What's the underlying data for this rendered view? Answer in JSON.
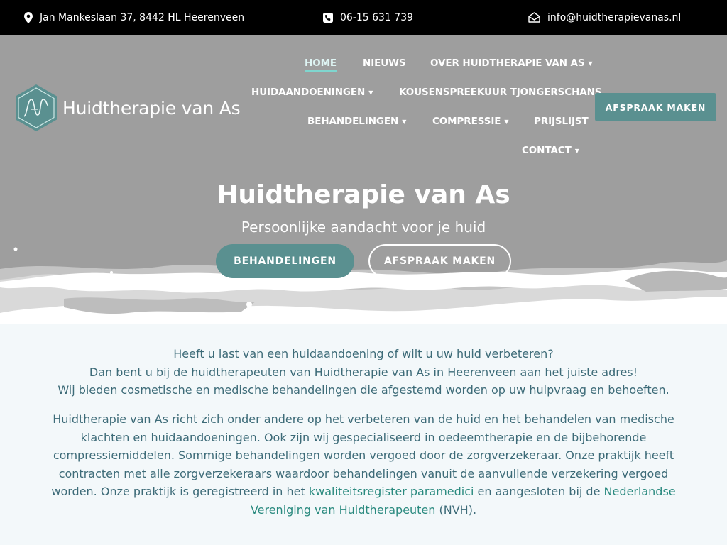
{
  "topbar": {
    "address": "Jan Mankeslaan 37, 8442 HL Heerenveen",
    "phone": "06-15 631 739",
    "email": "info@huidtherapievanas.nl"
  },
  "logo": {
    "text": "Huidtherapie van As"
  },
  "nav": {
    "items": [
      {
        "label": "HOME"
      },
      {
        "label": "NIEUWS"
      },
      {
        "label": "OVER HUIDTHERAPIE VAN AS"
      },
      {
        "label": "HUIDAANDOENINGEN"
      },
      {
        "label": "KOUSENSPREEKUUR TJONGERSCHANS"
      },
      {
        "label": "BEHANDELINGEN"
      },
      {
        "label": "COMPRESSIE"
      },
      {
        "label": "PRIJSLIJST"
      },
      {
        "label": "CONTACT"
      }
    ],
    "cta": "AFSPRAAK MAKEN"
  },
  "hero": {
    "title": "Huidtherapie van As",
    "subtitle": "Persoonlijke aandacht voor je huid",
    "primary_button": "BEHANDELINGEN",
    "secondary_button": "AFSPRAAK MAKEN"
  },
  "content": {
    "intro_lines": [
      "Heeft u last van een huidaandoening of wilt u uw huid verbeteren?",
      "Dan bent u bij de huidtherapeuten van Huidtherapie van As in Heerenveen aan het juiste adres!",
      "Wij bieden cosmetische en medische behandelingen die afgestemd worden op uw hulpvraag en behoeften."
    ],
    "body_start": "Huidtherapie van As richt zich onder andere op het verbeteren van de huid en het behandelen van medische klachten en huidaandoeningen. Ook zijn wij gespecialiseerd in oedeemtherapie en de bijbehorende compressiemiddelen. Sommige behandelingen worden vergoed door de zorgverzekeraar. Onze praktijk heeft contracten met alle zorgverzekeraars waardoor behandelingen vanuit de aanvullende verzekering vergoed worden. Onze praktijk is geregistreerd in het ",
    "link1": "kwaliteitsregister paramedici",
    "body_mid": " en aangesloten bij de ",
    "link2": "Nederlandse Vereniging van Huidtherapeuten",
    "body_end": " (NVH)."
  },
  "colors": {
    "topbar_bg": "#000000",
    "hero_bg": "#9e9e9e",
    "accent": "#5a9090",
    "link": "#2a8a7f",
    "text": "#3d6b78",
    "page_bg": "#f3f8fa"
  },
  "icons": {
    "address": "map-pin-icon",
    "phone": "phone-icon",
    "email": "envelope-icon",
    "caret": "chevron-down-icon"
  }
}
